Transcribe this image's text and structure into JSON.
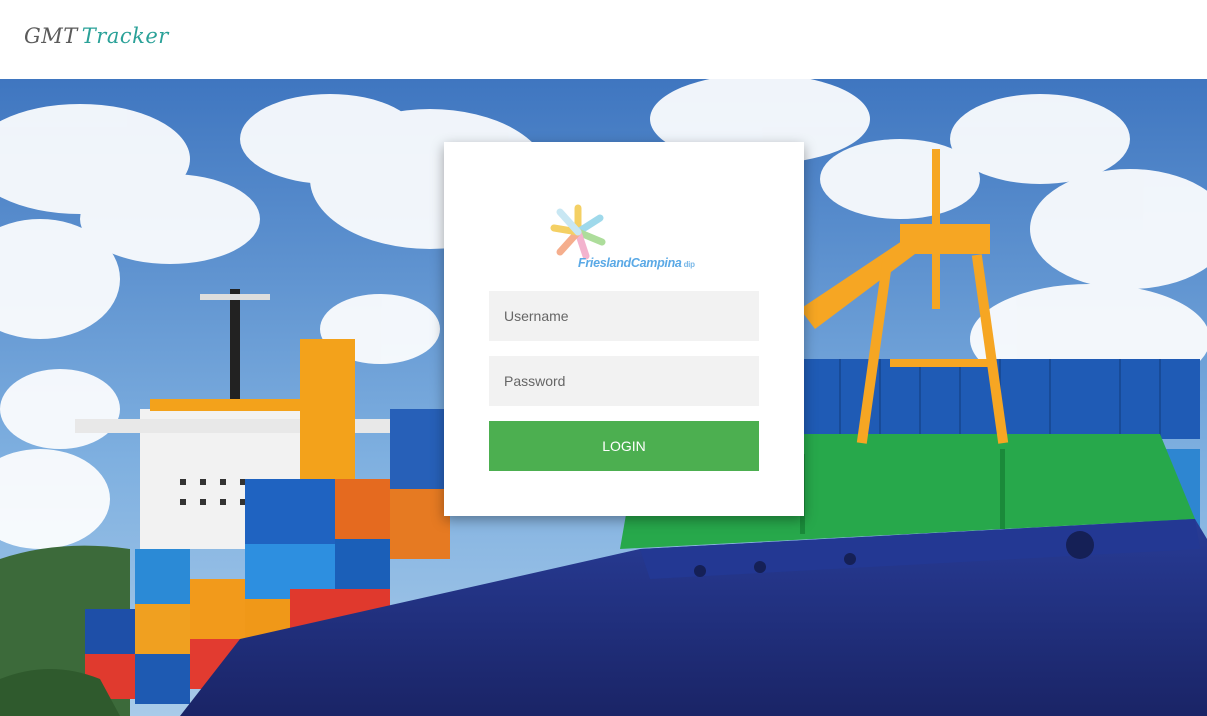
{
  "header": {
    "brand_part1": "GMT",
    "brand_part2": "Tracker"
  },
  "login_card": {
    "logo": {
      "text": "FrieslandCampina",
      "suffix": "dip"
    },
    "username_placeholder": "Username",
    "password_placeholder": "Password",
    "login_label": "LOGIN"
  },
  "colors": {
    "login_button": "#4caf50",
    "field_bg": "#f2f2f2",
    "brand_teal": "#2aa198",
    "brand_gray": "#5b5b5b"
  }
}
